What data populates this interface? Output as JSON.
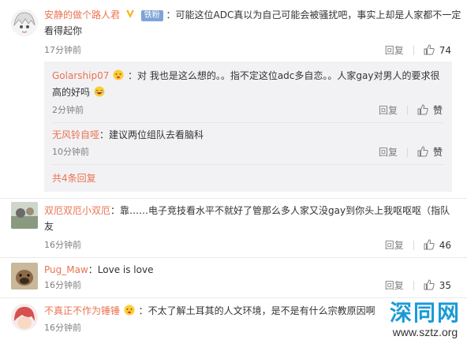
{
  "comments": [
    {
      "username": "安静的做个路人君",
      "badge": "铁粉",
      "text_line1": "：可能这位ADC真以为自己可能会被骚扰吧，事实上却是人家都不一定",
      "text_line2": "看得起你",
      "time": "17分钟前",
      "reply_label": "回复",
      "likes": "74"
    },
    {
      "username": "双厄双厄小双厄",
      "text_line1": "：靠……电子竞技看水平不就好了管那么多人家又没gay到你头上我呕呕呕（指队",
      "text_line2": "友",
      "time": "16分钟前",
      "reply_label": "回复",
      "likes": "46"
    },
    {
      "username": "Pug_Maw",
      "text_line1": "：Love is love",
      "time": "16分钟前",
      "reply_label": "回复",
      "likes": "35"
    },
    {
      "username": "不真正不作为锤锤",
      "text_line1": "：不太了解土耳其的人文环境，是不是有什么宗教原因啊",
      "time": "16分钟前"
    }
  ],
  "sub_replies": [
    {
      "username": "Golarship07",
      "text_line1": "：对 我也是这么想的。。指不定这位adc多自恋。。人家gay对男人的要求很",
      "text_line2": "高的好吗",
      "time": "2分钟前",
      "reply_label": "回复",
      "like_label": "赞"
    },
    {
      "username": "无风铃自哑",
      "text_line1": "：建议两位组队去看脑科",
      "time": "10分钟前",
      "reply_label": "回复",
      "like_label": "赞"
    }
  ],
  "more_replies": "共4条回复",
  "watermark": {
    "title": "深同网",
    "url": "www.sztz.org"
  },
  "colors": {
    "username": "#eb7350",
    "badge": "#7ea4d6",
    "watermark": "#1a9bd7"
  }
}
